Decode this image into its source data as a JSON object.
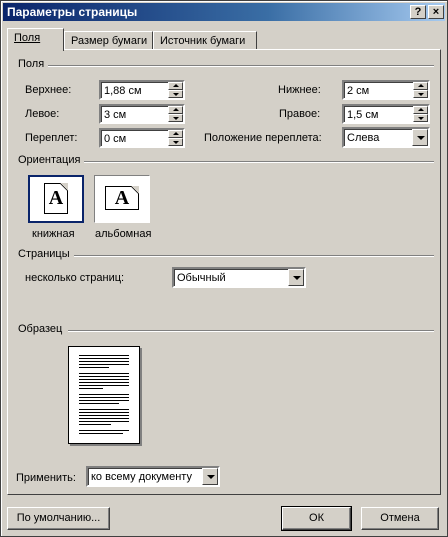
{
  "window": {
    "title": "Параметры страницы",
    "help_glyph": "?",
    "close_glyph": "×"
  },
  "tabs": [
    {
      "label": "Поля",
      "active": true
    },
    {
      "label": "Размер бумаги",
      "active": false
    },
    {
      "label": "Источник бумаги",
      "active": false
    }
  ],
  "margins": {
    "section_label": "Поля",
    "top": {
      "label": "Верхнее:",
      "value": "1,88 см"
    },
    "bottom": {
      "label": "Нижнее:",
      "value": "2 см"
    },
    "left": {
      "label": "Левое:",
      "value": "3 см"
    },
    "right": {
      "label": "Правое:",
      "value": "1,5 см"
    },
    "gutter": {
      "label": "Переплет:",
      "value": "0 см"
    },
    "gutter_position": {
      "label": "Положение переплета:",
      "value": "Слева"
    }
  },
  "orientation": {
    "section_label": "Ориентация",
    "portrait": {
      "label": "книжная",
      "glyph": "A",
      "selected": true
    },
    "landscape": {
      "label": "альбомная",
      "glyph": "A",
      "selected": false
    }
  },
  "pages": {
    "section_label": "Страницы",
    "multiple_pages": {
      "label": "несколько страниц:",
      "value": "Обычный"
    }
  },
  "preview": {
    "section_label": "Образец"
  },
  "apply_to": {
    "label": "Применить:",
    "value": "ко всему документу"
  },
  "buttons": {
    "default_label": "По умолчанию...",
    "ok_label": "ОК",
    "cancel_label": "Отмена"
  },
  "colors": {
    "dialog_face": "#d4d0c8",
    "titlebar_start": "#0a246a",
    "titlebar_end": "#a6caf0",
    "selection_border": "#0a246a"
  }
}
